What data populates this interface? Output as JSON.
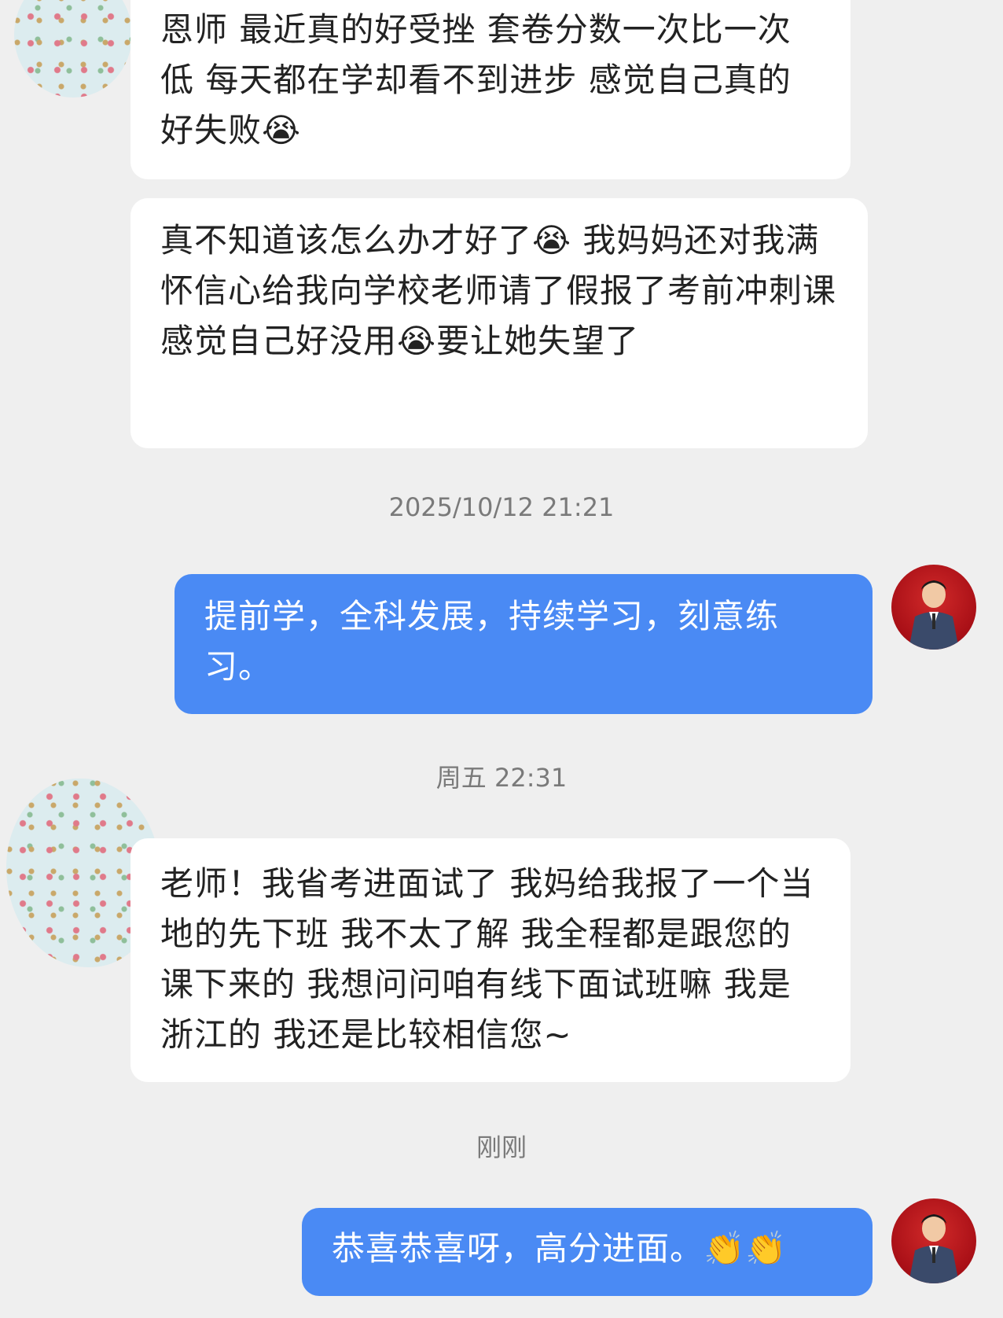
{
  "messages": [
    {
      "side": "left",
      "text": "恩师 最近真的好受挫 套卷分数一次比一次低 每天都在学却看不到进步 感觉自己真的好失败😭"
    },
    {
      "side": "left",
      "text": "真不知道该怎么办才好了😭 我妈妈还对我满怀信心给我向学校老师请了假报了考前冲刺课  感觉自己好没用😭要让她失望了"
    },
    {
      "side": "right",
      "text": "提前学，全科发展，持续学习，刻意练习。"
    },
    {
      "side": "left",
      "text": "老师！我省考进面试了 我妈给我报了一个当地的先下班 我不太了解 我全程都是跟您的课下来的 我想问问咱有线下面试班嘛 我是浙江的 我还是比较相信您~"
    },
    {
      "side": "right",
      "text": "恭喜恭喜呀，高分进面。👏👏"
    }
  ],
  "timestamps": [
    "2025/10/12 21:21",
    "周五 22:31",
    "刚刚"
  ],
  "colors": {
    "background": "#efefef",
    "left_bubble": "#ffffff",
    "right_bubble": "#4a8af4",
    "timestamp_text": "#7a7a7a",
    "avatar_red": "#c41e24"
  },
  "icons": {
    "student_avatar": "polka-dot-avatar",
    "teacher_avatar": "teacher-portrait-avatar"
  }
}
